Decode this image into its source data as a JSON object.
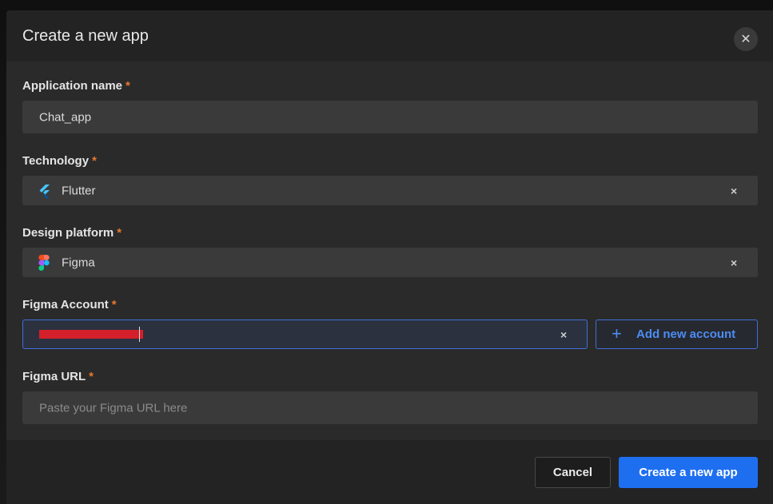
{
  "modal": {
    "title": "Create a new app",
    "close_icon": "close-icon"
  },
  "form": {
    "required_mark": "*",
    "app_name": {
      "label": "Application name",
      "value": "Chat_app"
    },
    "technology": {
      "label": "Technology",
      "value": "Flutter",
      "icon": "flutter-icon",
      "clear": "×"
    },
    "design_platform": {
      "label": "Design platform",
      "value": "Figma",
      "icon": "figma-icon",
      "clear": "×"
    },
    "figma_account": {
      "label": "Figma Account",
      "value": "",
      "clear": "×",
      "add_button": "Add new account",
      "add_icon": "plus-icon"
    },
    "figma_url": {
      "label": "Figma URL",
      "value": "",
      "placeholder": "Paste your Figma URL here"
    }
  },
  "footer": {
    "cancel": "Cancel",
    "create": "Create a new app"
  },
  "colors": {
    "accent": "#1e6ff0",
    "required": "#e8782f",
    "focus_border": "#3f6fd8"
  }
}
